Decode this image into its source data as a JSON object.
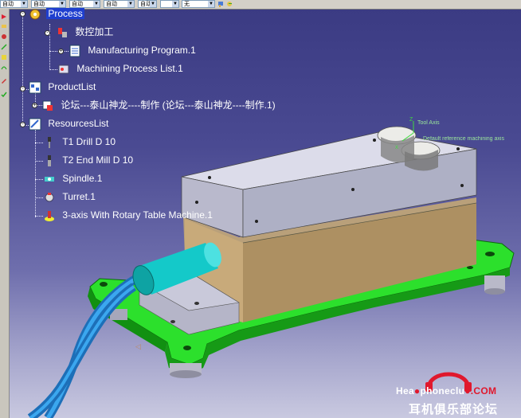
{
  "toolbar": {
    "selects": [
      "自动",
      "自动",
      "自动",
      "自动",
      "自动",
      "无"
    ]
  },
  "tree": {
    "root_label": "Process",
    "cnc_label": "数控加工",
    "manufacturing_program": "Manufacturing Program.1",
    "machining_process_list": "Machining Process List.1",
    "product_list": "ProductList",
    "product_item": "论坛---泰山神龙----制作 (论坛---泰山神龙----制作.1)",
    "resources_list": "ResourcesList",
    "resources": [
      "T1 Drill D 10",
      "T2 End Mill D 10",
      "Spindle.1",
      "Turret.1",
      "3-axis With Rotary Table Machine.1"
    ]
  },
  "axes": {
    "tool_axis": "Tool Axis",
    "reference_axis": "Default reference machining axis"
  },
  "watermark": {
    "site_part1": "Hea",
    "site_part2": "phonec",
    "site_part3": "lu",
    "site_part4": ".COM",
    "chinese": "耳机俱乐部论坛"
  },
  "colors": {
    "background_top": "#3a3a82",
    "background_bottom": "#c9c9e0",
    "fixture_green": "#28e028",
    "body_gray": "#c8c8d8",
    "core_tan": "#b49a6e",
    "hose_blue": "#2a8ad8",
    "tree_highlight": "#1f3fcf"
  }
}
